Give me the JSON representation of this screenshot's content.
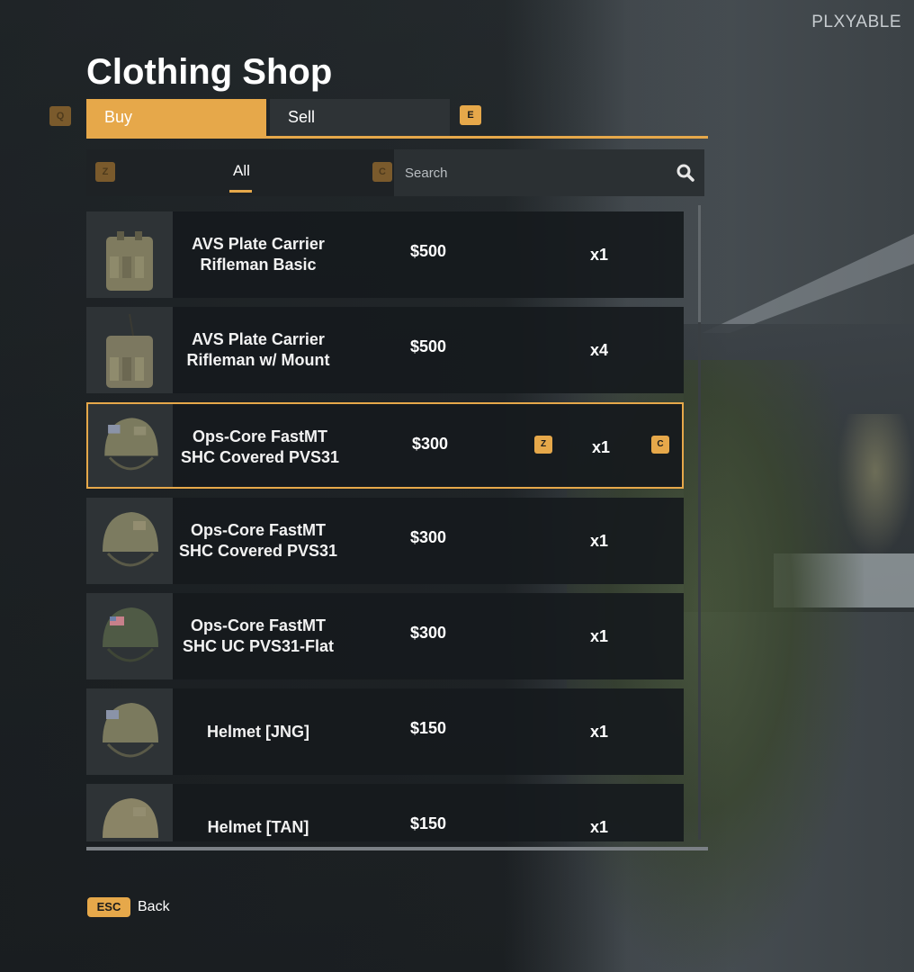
{
  "watermark": "PLXYABLE",
  "title": "Clothing Shop",
  "tabs": {
    "left_key": "Q",
    "right_key": "E",
    "buy": "Buy",
    "sell": "Sell"
  },
  "filter": {
    "left_key": "Z",
    "right_key": "C",
    "category": "All"
  },
  "search": {
    "placeholder": "Search",
    "icon": "search-icon"
  },
  "items": [
    {
      "name": "AVS Plate Carrier\nRifleman Basic",
      "price": "$500",
      "qty": "x1",
      "icon": "plate-carrier-icon"
    },
    {
      "name": "AVS Plate Carrier\nRifleman w/ Mount",
      "price": "$500",
      "qty": "x4",
      "icon": "plate-carrier-icon"
    },
    {
      "name": "Ops-Core FastMT\nSHC Covered PVS31",
      "price": "$300",
      "qty": "x1",
      "icon": "helmet-icon",
      "selected": true,
      "dec_key": "Z",
      "inc_key": "C"
    },
    {
      "name": "Ops-Core FastMT\nSHC Covered PVS31",
      "price": "$300",
      "qty": "x1",
      "icon": "helmet-icon"
    },
    {
      "name": "Ops-Core FastMT\nSHC UC PVS31-Flat",
      "price": "$300",
      "qty": "x1",
      "icon": "helmet-icon"
    },
    {
      "name": "Helmet [JNG]",
      "price": "$150",
      "qty": "x1",
      "icon": "helmet-icon"
    },
    {
      "name": "Helmet [TAN]",
      "price": "$150",
      "qty": "x1",
      "icon": "helmet-icon"
    }
  ],
  "footer": {
    "key": "ESC",
    "label": "Back"
  },
  "colors": {
    "accent": "#e6a84a",
    "row_bg": "#161a1d",
    "panel": "#2e3336"
  }
}
